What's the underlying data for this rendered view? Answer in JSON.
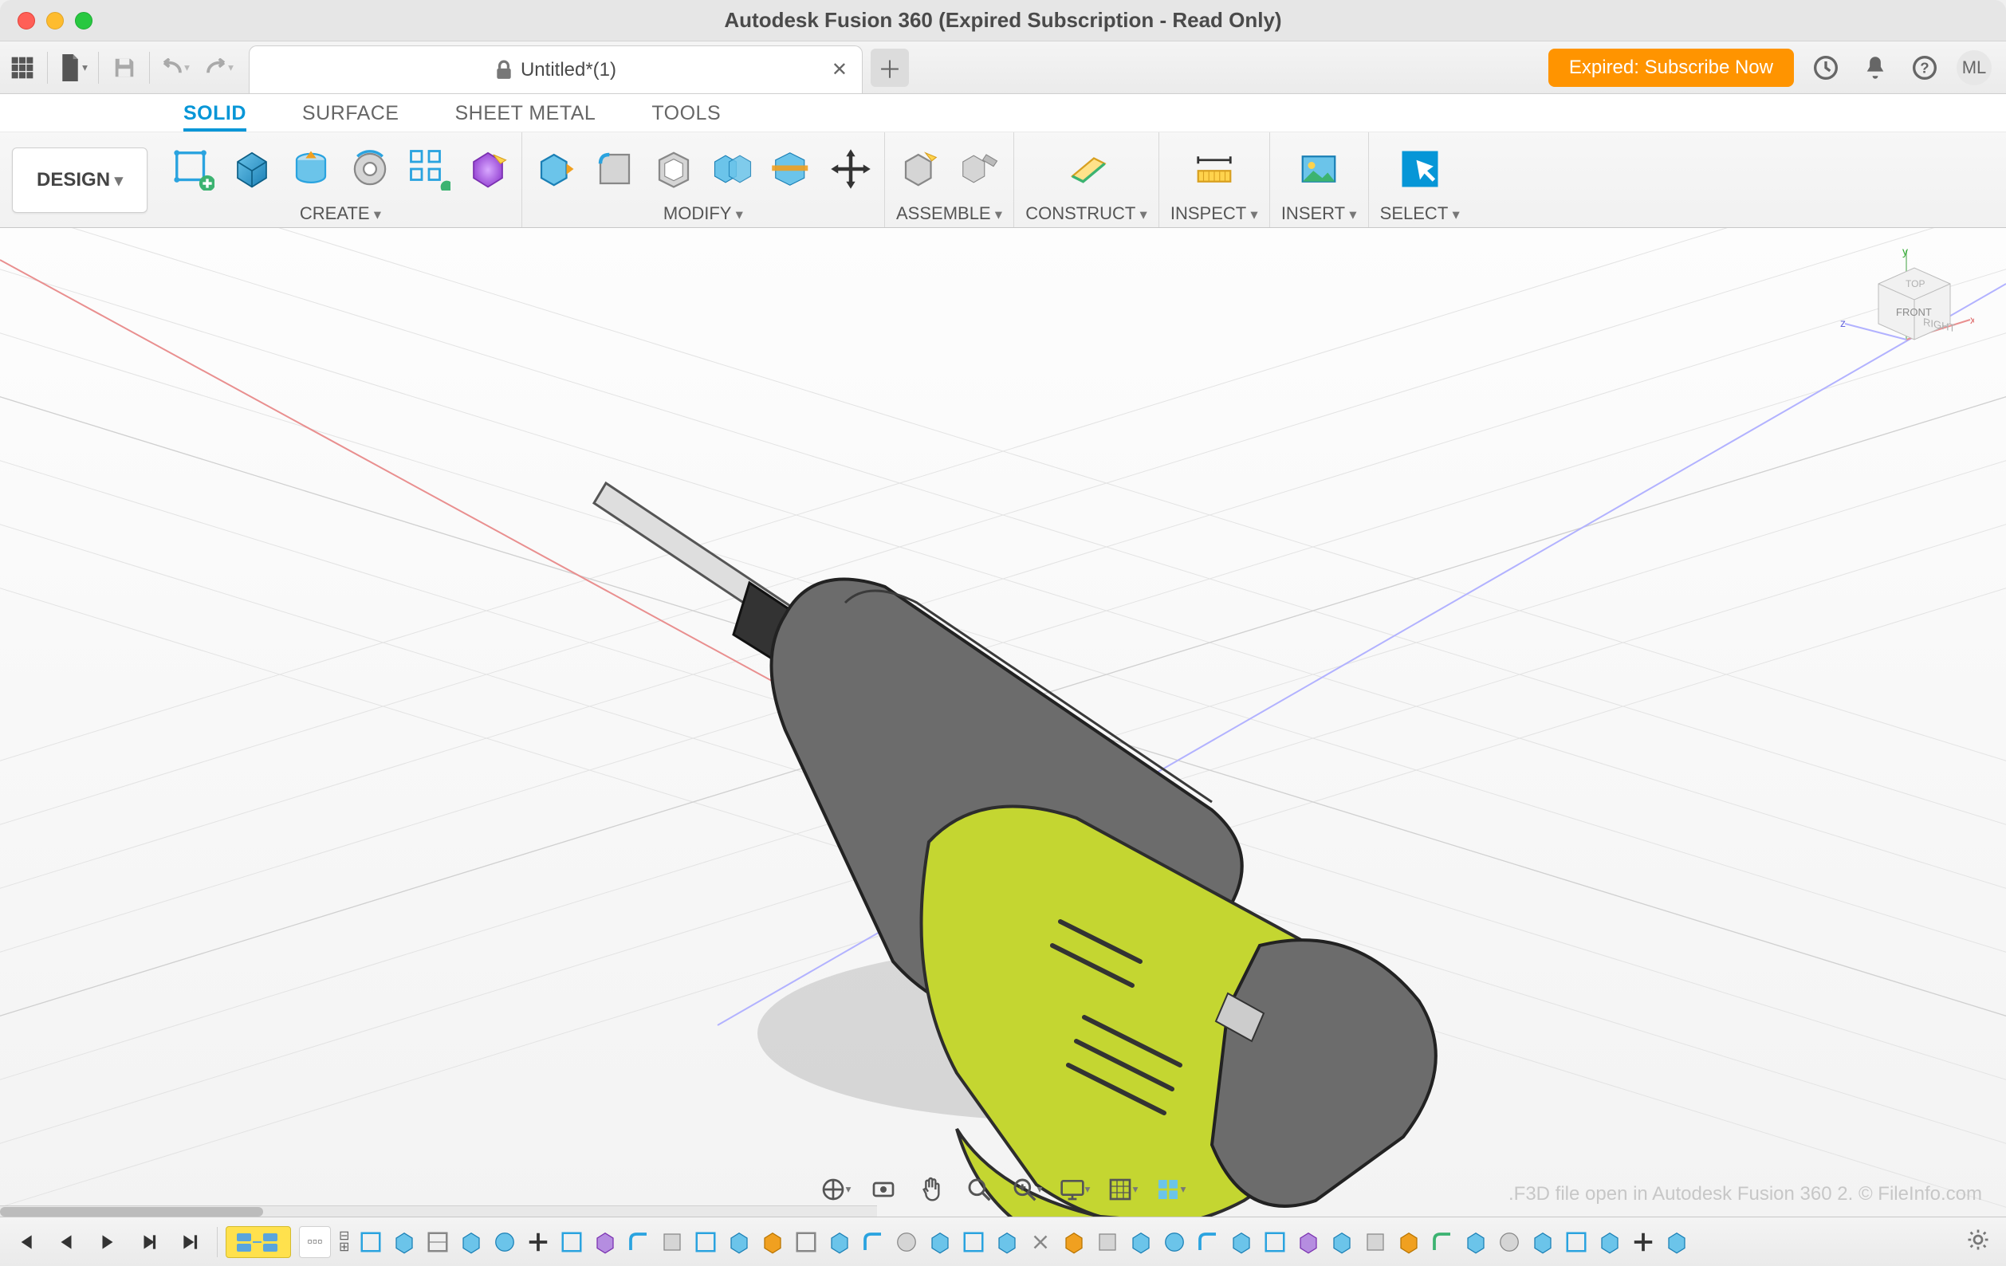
{
  "window": {
    "title": "Autodesk Fusion 360 (Expired Subscription - Read Only)"
  },
  "qat": {
    "subscribe": "Expired: Subscribe Now",
    "avatar": "ML"
  },
  "tab": {
    "title": "Untitled*(1)"
  },
  "ribbon": {
    "tabs": {
      "solid": "SOLID",
      "surface": "SURFACE",
      "sheet_metal": "SHEET METAL",
      "tools": "TOOLS"
    },
    "design_label": "DESIGN",
    "groups": {
      "create": "CREATE",
      "modify": "MODIFY",
      "assemble": "ASSEMBLE",
      "construct": "CONSTRUCT",
      "inspect": "INSPECT",
      "insert": "INSERT",
      "select": "SELECT"
    }
  },
  "viewcube": {
    "front": "FRONT",
    "right": "RIGHT",
    "top": "TOP",
    "axes": {
      "x": "x",
      "y": "y",
      "z": "z"
    }
  },
  "watermark": ".F3D file open in Autodesk Fusion 360 2. © FileInfo.com",
  "timeline": {
    "spacer": "▫▫▫"
  }
}
